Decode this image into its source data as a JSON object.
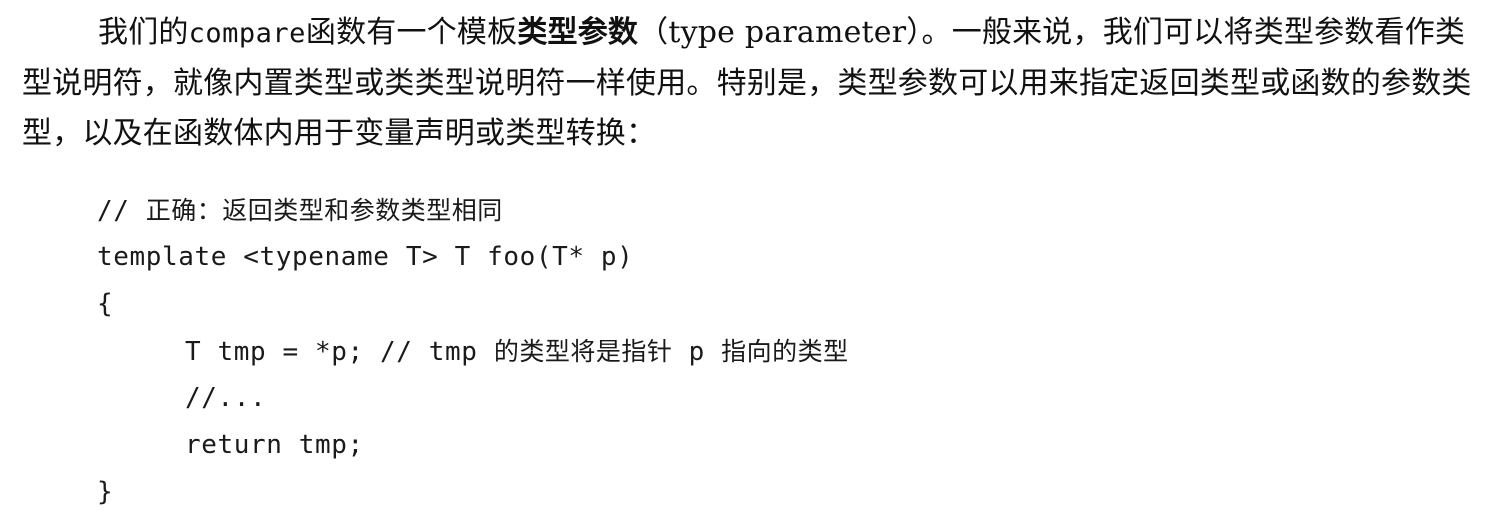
{
  "paragraph": {
    "seg1": "我们的",
    "seg2": "compare",
    "seg3": "函数有一个模板",
    "seg4": "类型参数",
    "seg5": "（type parameter）。一般来说，我们可以将类型参数看作类型说明符，就像内置类型或类类型说明符一样使用。特别是，类型参数可以用来指定返回类型或函数的参数类型，以及在函数体内用于变量声明或类型转换："
  },
  "code": {
    "line1_prefix": "// ",
    "line1_comment": "正确：返回类型和参数类型相同",
    "line2": "template <typename T> T foo(T* p)",
    "line3": "{",
    "line4_code": "T tmp = *p; // tmp ",
    "line4_c1": "的类型将是指针",
    "line4_mid": " p ",
    "line4_c2": "指向的类型",
    "line5": "//...",
    "line6": "return tmp;",
    "line7": "}"
  }
}
